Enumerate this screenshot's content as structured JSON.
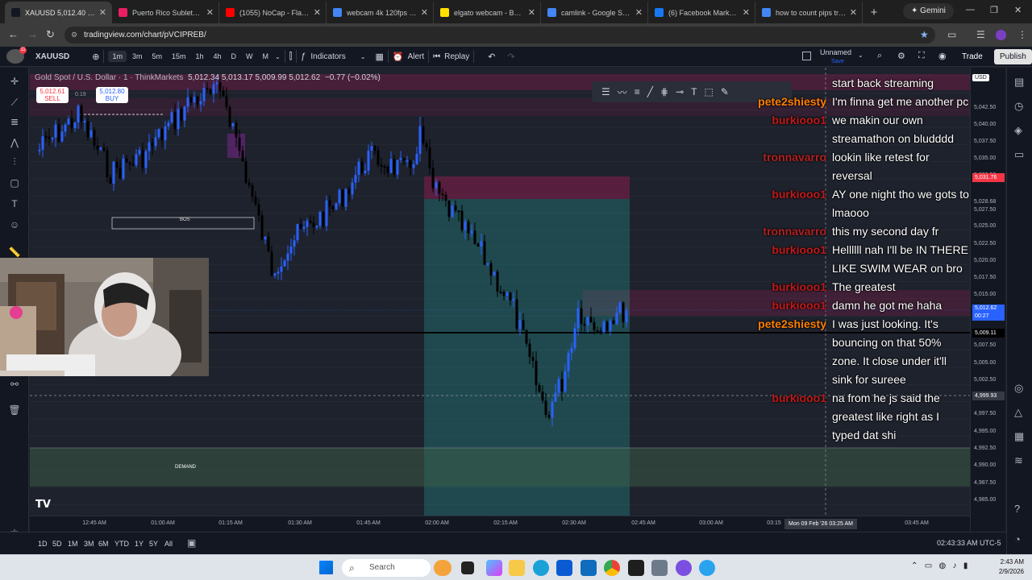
{
  "browser": {
    "tabs": [
      {
        "title": "XAUUSD 5,012.40 ▲ +0.0",
        "favicon_color": "#131722",
        "active": true
      },
      {
        "title": "Puerto Rico Sublets, Sh",
        "favicon_color": "#e91e63",
        "active": false
      },
      {
        "title": "(1055) NoCap - Flaws (O",
        "favicon_color": "#ff0000",
        "active": false
      },
      {
        "title": "webcam 4k 120fps - Go",
        "favicon_color": "#4285f4",
        "active": false
      },
      {
        "title": "elgato webcam - Best B",
        "favicon_color": "#ffe000",
        "active": false
      },
      {
        "title": "camlink - Google Searc",
        "favicon_color": "#4285f4",
        "active": false
      },
      {
        "title": "(6) Facebook Marketpla",
        "favicon_color": "#1877f2",
        "active": false
      },
      {
        "title": "how to count pips tradi",
        "favicon_color": "#4285f4",
        "active": false
      }
    ],
    "new_tab": "+",
    "gemini_label": "Gemini",
    "url": "tradingview.com/chart/pVCIPREB/"
  },
  "toolbar": {
    "symbol": "XAUUSD",
    "timeframes": [
      "1m",
      "3m",
      "5m",
      "15m",
      "1h",
      "4h",
      "D",
      "W",
      "M"
    ],
    "active_timeframe": "1m",
    "indicators_label": "Indicators",
    "alert_label": "Alert",
    "replay_label": "Replay",
    "layout_name": "Unnamed",
    "layout_sub": "Save",
    "trade_label": "Trade",
    "publish_label": "Publish"
  },
  "chart": {
    "legend_title": "Gold Spot / U.S. Dollar · 1 · ThinkMarkets",
    "ohlc": "5,012.34 5,013.17 5,009.99 5,012.62",
    "change": "−0.77 (−0.02%)",
    "sell_price": "5,012.61",
    "sell_label": "SELL",
    "buy_price": "5,012.80",
    "buy_label": "BUY",
    "spread": "0.19",
    "bos_label": "BOS",
    "demand_label": "DEMAND",
    "price_scale_currency": "USD",
    "price_ticks": [
      "5,042.50",
      "5,040.00",
      "5,037.50",
      "5,035.00",
      "5,032.50",
      "5,028.68",
      "5,027.50",
      "5,025.00",
      "5,022.50",
      "5,020.00",
      "5,017.50",
      "5,015.00",
      "5,012.50",
      "5,007.50",
      "5,005.00",
      "5,002.50",
      "4,997.50",
      "4,995.00",
      "4,992.50",
      "4,990.00",
      "4,987.50",
      "4,985.00"
    ],
    "price_labels": {
      "level_high": "5,031.76",
      "current": "5,012.62",
      "countdown": "00:27",
      "line": "5,009.11",
      "crosshair": "4,999.93"
    },
    "time_ticks": [
      "12:45 AM",
      "01:00 AM",
      "01:15 AM",
      "01:30 AM",
      "01:45 AM",
      "02:00 AM",
      "02:15 AM",
      "02:30 AM",
      "02:45 AM",
      "03:00 AM",
      "03:15",
      "03:45 AM"
    ],
    "crosshair_time": "Mon 09 Feb '26   03:25 AM",
    "ranges": [
      "1D",
      "5D",
      "1M",
      "3M",
      "6M",
      "YTD",
      "1Y",
      "5Y",
      "All"
    ],
    "clock": "02:43:33 AM UTC-5",
    "colors": {
      "bg": "#1e222d",
      "bull": "#2962ff",
      "bear": "#000000",
      "supply": "#c2185b",
      "demand": "#26a69a"
    }
  },
  "chat": [
    {
      "user": "",
      "text": "start back streaming",
      "color": ""
    },
    {
      "user": "pete2shiesty",
      "text": "I'm finna get me another pc",
      "color": "pete"
    },
    {
      "user": "burkiooo1",
      "text": "we makin our own streamathon on bludddd",
      "color": "burk"
    },
    {
      "user": "tronnavarro",
      "text": "lookin like retest for reversal",
      "color": "tron"
    },
    {
      "user": "burkiooo1",
      "text": "AY one night tho we gots to lmaooo",
      "color": "burk"
    },
    {
      "user": "tronnavarro",
      "text": "this my second day fr",
      "color": "tron"
    },
    {
      "user": "burkiooo1",
      "text": "Hellllll nah I'll be IN THERE LIKE SWIM WEAR on bro",
      "color": "burk"
    },
    {
      "user": "burkiooo1",
      "text": "The greatest",
      "color": "burk"
    },
    {
      "user": "burkiooo1",
      "text": "damn he got me haha",
      "color": "burk"
    },
    {
      "user": "pete2shiesty",
      "text": "I was just looking. It's bouncing on that 50% zone. It close under it'll sink for sureee",
      "color": "pete"
    },
    {
      "user": "burkiooo1",
      "text": "na from he js said the greatest like right as I typed dat shi",
      "color": "burk"
    }
  ],
  "taskbar": {
    "search_placeholder": "Search",
    "time": "2:43 AM",
    "date": "2/9/2026"
  }
}
